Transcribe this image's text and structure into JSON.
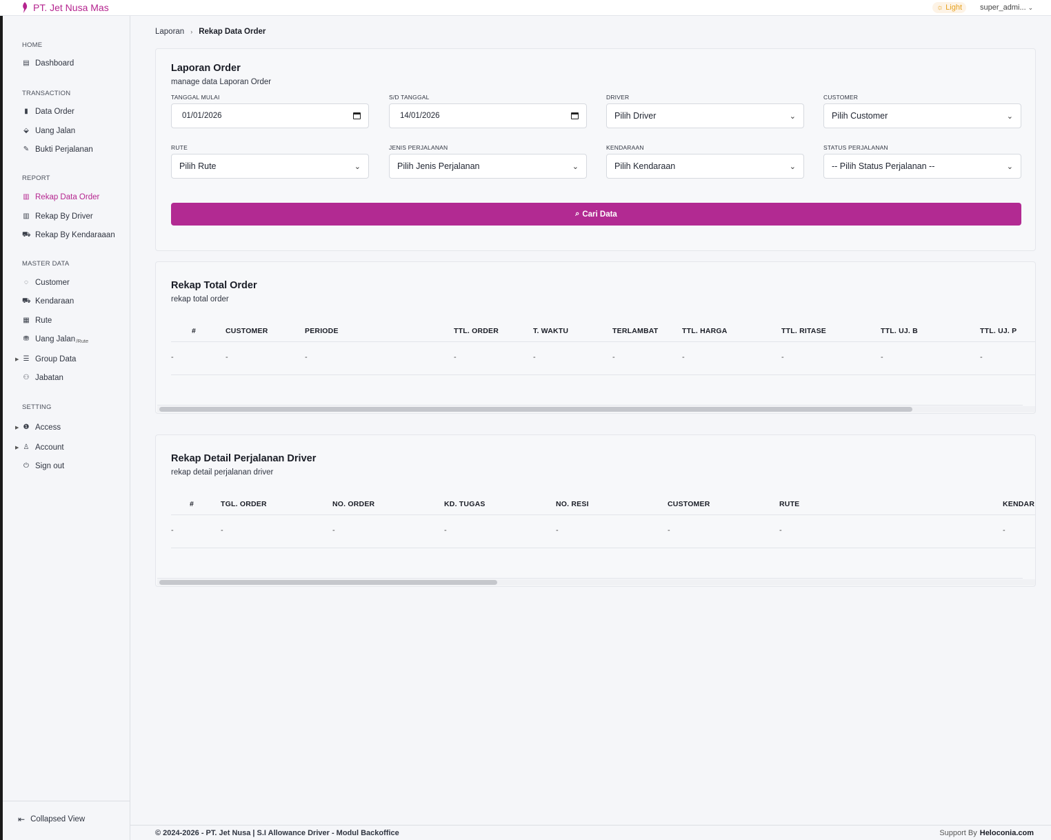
{
  "app": {
    "brand_name": "PT. Jet Nusa Mas",
    "theme_label": "Light",
    "user_name": "super_admi..."
  },
  "sidebar": {
    "sections": {
      "home": "HOME",
      "transaction": "TRANSACTION",
      "report": "REPORT",
      "master_data": "MASTER DATA",
      "setting": "SETTING"
    },
    "items": {
      "dashboard": "Dashboard",
      "data_order": "Data Order",
      "uang_jalan": "Uang Jalan",
      "bukti_perjalanan": "Bukti Perjalanan",
      "rekap_data_order": "Rekap Data Order",
      "rekap_by_driver": "Rekap By Driver",
      "rekap_by_kendaraan": "Rekap By Kendaraaan",
      "customer": "Customer",
      "kendaraan": "Kendaraan",
      "rute": "Rute",
      "uang_jalan_rute": "Uang Jalan",
      "uang_jalan_rute_sub": "/Rute",
      "group_data": "Group Data",
      "jabatan": "Jabatan",
      "access": "Access",
      "account": "Account",
      "sign_out": "Sign out"
    },
    "collapsed_view": "Collapsed View"
  },
  "breadcrumb": {
    "parent": "Laporan",
    "current": "Rekap Data Order"
  },
  "filter_card": {
    "title": "Laporan Order",
    "subtitle": "manage data Laporan Order",
    "labels": {
      "tanggal_mulai": "TANGGAL MULAI",
      "sd_tanggal": "S/D TANGGAL",
      "driver": "DRIVER",
      "customer": "CUSTOMER",
      "rute": "RUTE",
      "jenis_perjalanan": "JENIS PERJALANAN",
      "kendaraan": "KENDARAAN",
      "status_perjalanan": "STATUS PERJALANAN"
    },
    "values": {
      "tanggal_mulai": "01/01/2026",
      "sd_tanggal": "14/01/2026",
      "driver": "Pilih Driver",
      "customer": "Pilih Customer",
      "rute": "Pilih Rute",
      "jenis_perjalanan": "Pilih Jenis Perjalanan",
      "kendaraan": "Pilih Kendaraan",
      "status_perjalanan": "-- Pilih Status Perjalanan --"
    },
    "search_label": "Cari Data"
  },
  "total_card": {
    "title": "Rekap Total Order",
    "subtitle": "rekap total order",
    "columns": [
      "#",
      "CUSTOMER",
      "PERIODE",
      "TTL. ORDER",
      "T. WAKTU",
      "TERLAMBAT",
      "TTL. HARGA",
      "TTL. RITASE",
      "TTL. UJ. B",
      "TTL. UJ. P"
    ],
    "row": [
      "-",
      "-",
      "-",
      "-",
      "-",
      "-",
      "-",
      "-",
      "-",
      "-"
    ]
  },
  "detail_card": {
    "title": "Rekap Detail Perjalanan Driver",
    "subtitle": "rekap detail perjalanan driver",
    "columns": [
      "#",
      "TGL. ORDER",
      "NO. ORDER",
      "KD. TUGAS",
      "NO. RESI",
      "CUSTOMER",
      "RUTE",
      "KENDAR"
    ],
    "row": [
      "-",
      "-",
      "-",
      "-",
      "-",
      "-",
      "-",
      "-"
    ]
  },
  "footer": {
    "copyright": "© 2024-2026 - PT. Jet Nusa | S.I Allowance Driver - Modul Backoffice",
    "support_label": "Support By",
    "support_name": "Heloconia.com"
  },
  "colors": {
    "accent": "#b22a92",
    "brand": "#b5248f",
    "theme_badge": "#e6a11d"
  }
}
